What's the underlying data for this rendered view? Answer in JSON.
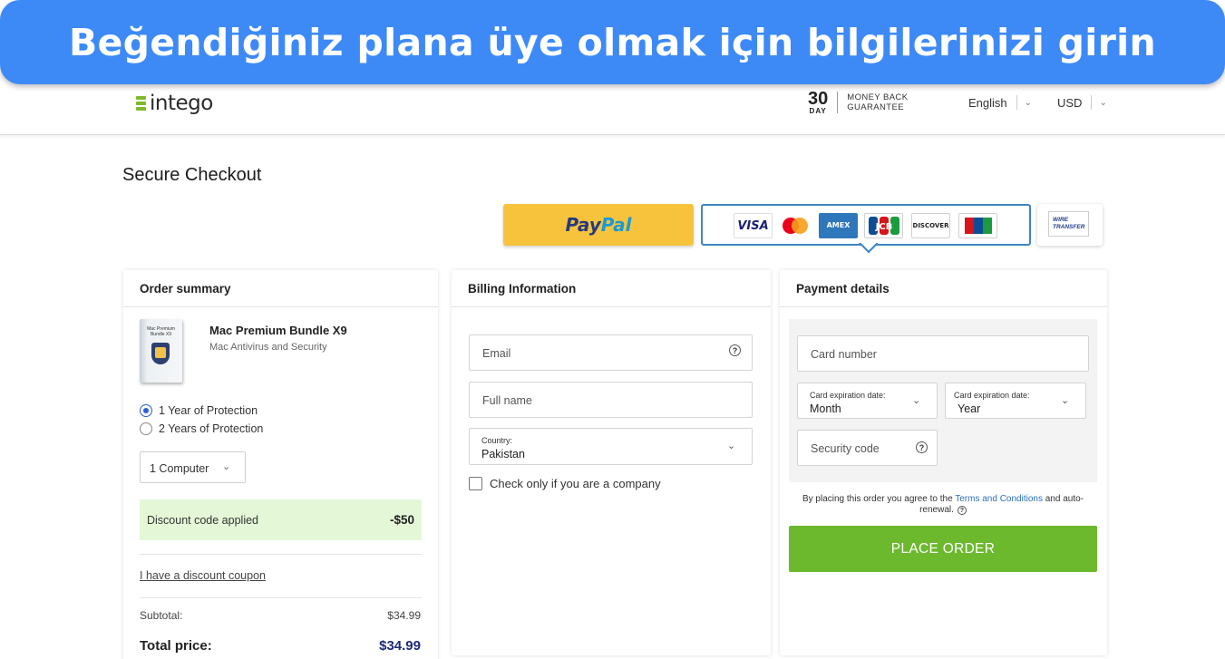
{
  "banner": {
    "text": "Beğendiğiniz plana üye olmak için bilgilerinizi girin"
  },
  "header": {
    "logo_text": "intego",
    "guarantee_number": "30",
    "guarantee_day": "DAY",
    "guarantee_line1": "MONEY BACK",
    "guarantee_line2": "GUARANTEE",
    "language": "English",
    "currency": "USD"
  },
  "page_title": "Secure Checkout",
  "payment_methods": {
    "paypal_part1": "Pay",
    "paypal_part2": "Pal",
    "cards": [
      "VISA",
      "Mastercard",
      "AMEX",
      "JCB",
      "DISCOVER",
      "UnionPay"
    ],
    "wire_line1": "WIRE",
    "wire_line2": "TRANSFER",
    "colors": {
      "visa": "#1a1f71",
      "mc_red": "#eb001b",
      "mc_yellow": "#f79e1b",
      "amex": "#2e77bb",
      "discover_orange": "#f48120",
      "unionpay_red": "#d7141a"
    }
  },
  "order_summary": {
    "heading": "Order summary",
    "product_name": "Mac Premium Bundle X9",
    "product_subtitle": "Mac Antivirus and Security",
    "options": [
      {
        "label": "1 Year of Protection",
        "selected": true
      },
      {
        "label": "2 Years of Protection",
        "selected": false
      }
    ],
    "computers": "1 Computer",
    "discount_label": "Discount code applied",
    "discount_value": "-$50",
    "coupon_link": "I have a discount coupon",
    "subtotal_label": "Subtotal:",
    "subtotal_value": "$34.99",
    "total_label": "Total price:",
    "total_value": "$34.99"
  },
  "billing": {
    "heading": "Billing Information",
    "email_placeholder": "Email",
    "fullname_placeholder": "Full name",
    "country_label": "Country:",
    "country_value": "Pakistan",
    "company_checkbox": "Check only if you are a company"
  },
  "payment": {
    "heading": "Payment details",
    "card_number_placeholder": "Card number",
    "exp_label": "Card expiration date:",
    "month_value": "Month",
    "year_value": "Year",
    "security_placeholder": "Security code",
    "terms_before": "By placing this order you agree to the ",
    "terms_link": "Terms and Conditions",
    "terms_after": " and auto-renewal.",
    "place_order": "PLACE ORDER"
  },
  "colors": {
    "banner": "#3d8af7",
    "place_order": "#6cb92e",
    "discount_bg": "#e4f8d8",
    "accent_border": "#3d86c6"
  }
}
